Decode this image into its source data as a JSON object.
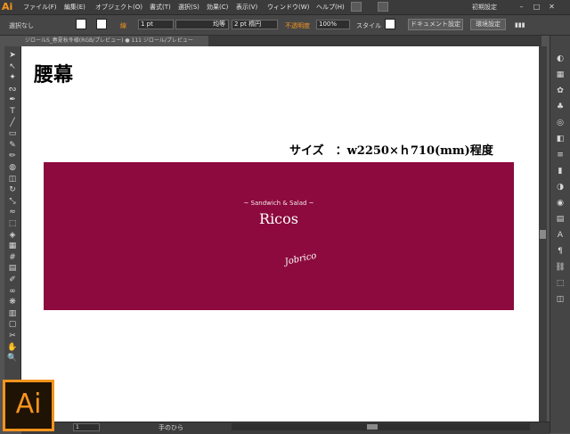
{
  "app": {
    "logo": "Ai"
  },
  "menu": [
    {
      "label": "ファイル(F)"
    },
    {
      "label": "編集(E)"
    },
    {
      "label": "オブジェクト(O)"
    },
    {
      "label": "書式(T)"
    },
    {
      "label": "選択(S)"
    },
    {
      "label": "効果(C)"
    },
    {
      "label": "表示(V)"
    },
    {
      "label": "ウィンドウ(W)"
    },
    {
      "label": "ヘルプ(H)"
    }
  ],
  "workspace": "初期設定",
  "control_bar": {
    "selection": "選択なし",
    "stroke_label": "線",
    "stroke_value": "1 pt",
    "profile_label": "均等",
    "brush_value": "2 pt 楕円",
    "opacity_label": "不透明度",
    "opacity_value": "100%",
    "style_label": "スタイル",
    "doc_setup": "ドキュメント設定",
    "preferences": "環境設定"
  },
  "document_tab": "ジロールS_春夏秋冬様(RGB/プレビュー) ● 111 ジロール/プレビュー",
  "artboard": {
    "heading": "腰幕",
    "size_note": "サイズ　：w2250×ｈ710(mm)程度",
    "banner": {
      "tagline": "~ Sandwich & Salad ~",
      "title": "Ricos",
      "signature": "Jobrico"
    }
  },
  "status_bar": {
    "zoom": "1",
    "tool": "手のひら"
  },
  "badge": {
    "logo": "Ai"
  },
  "colors": {
    "banner": "#8c0a3d",
    "accent": "#f7941d",
    "ui_dark": "#535353"
  },
  "tools": [
    "selection-icon",
    "direct-selection-icon",
    "magic-wand-icon",
    "lasso-icon",
    "pen-icon",
    "type-icon",
    "line-icon",
    "rectangle-icon",
    "brush-icon",
    "pencil-icon",
    "blob-brush-icon",
    "eraser-icon",
    "rotate-icon",
    "scale-icon",
    "warp-icon",
    "free-transform-icon",
    "shape-builder-icon",
    "perspective-icon",
    "mesh-icon",
    "gradient-icon",
    "eyedropper-icon",
    "blend-icon",
    "symbol-sprayer-icon",
    "graph-icon",
    "artboard-icon",
    "slice-icon",
    "hand-icon",
    "zoom-icon"
  ],
  "panel_icons": [
    "color-icon",
    "swatches-icon",
    "brushes-icon",
    "symbols-icon",
    "graphic-styles-icon",
    "layers-icon",
    "stroke-icon",
    "gradient-panel-icon",
    "transparency-icon",
    "appearance-icon",
    "align-icon",
    "character-icon",
    "paragraph-icon",
    "links-icon",
    "transform-icon",
    "pathfinder-icon"
  ]
}
